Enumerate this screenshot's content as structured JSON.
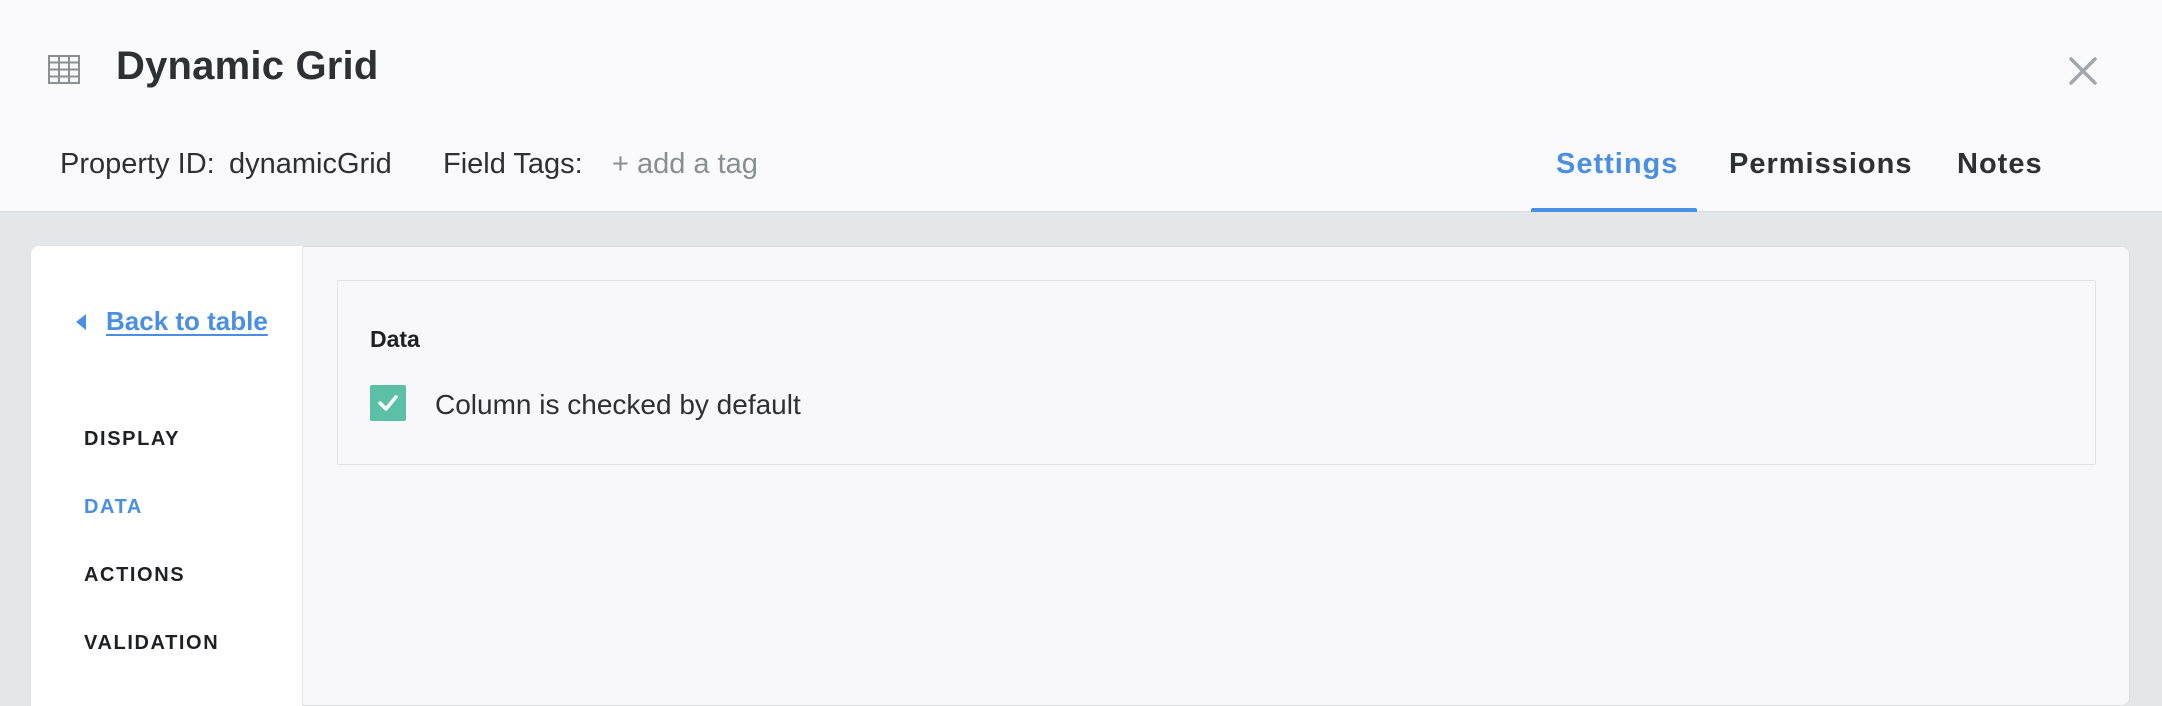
{
  "header": {
    "icon": "grid-icon",
    "title": "Dynamic Grid",
    "property_id_label": "Property ID:",
    "property_id_value": "dynamicGrid",
    "field_tags_label": "Field Tags:",
    "add_tag_label": "+ add a tag"
  },
  "tabs": [
    {
      "label": "Settings",
      "active": true
    },
    {
      "label": "Permissions",
      "active": false
    },
    {
      "label": "Notes",
      "active": false
    }
  ],
  "sidebar": {
    "back_label": "Back to table",
    "items": [
      {
        "label": "DISPLAY",
        "active": false
      },
      {
        "label": "DATA",
        "active": true
      },
      {
        "label": "ACTIONS",
        "active": false
      },
      {
        "label": "VALIDATION",
        "active": false
      }
    ]
  },
  "section": {
    "title": "Data",
    "checkbox_label": "Column is checked by default",
    "checked": true
  },
  "colors": {
    "accent": "#4a8fe2",
    "checkbox": "#5cc0a6",
    "background": "#e3e7ea"
  }
}
